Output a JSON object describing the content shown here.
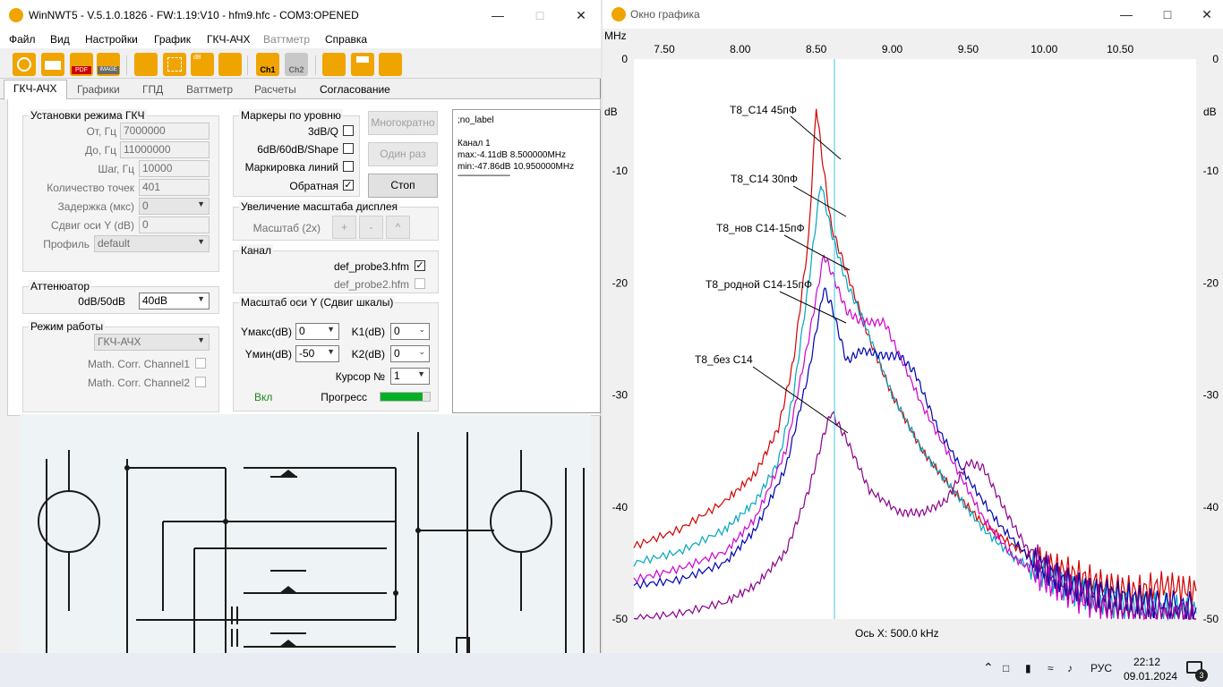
{
  "main_window": {
    "title": "WinNWT5 - V.5.1.0.1826 - FW:1.19:V10 - hfm9.hfc - COM3:OPENED",
    "menu": [
      "Файл",
      "Вид",
      "Настройки",
      "График",
      "ГКЧ-АЧХ",
      "Ваттметр",
      "Справка"
    ],
    "toolbar_icons": [
      "power-icon",
      "print-icon",
      "pdf-icon",
      "image-icon",
      "tools-icon",
      "grid-icon",
      "db-chart-icon",
      "calibrate-icon",
      "ch1-icon",
      "ch2-icon",
      "sweep-icon",
      "save-icon",
      "exchange-icon"
    ],
    "toolbar_text": {
      "pdf": "PDF",
      "image": "IMAGE",
      "db": "dB",
      "ch1": "Ch1",
      "ch2": "Ch2"
    },
    "tabs": [
      "ГКЧ-АЧХ",
      "Графики",
      "ГПД",
      "Ваттметр",
      "Расчеты",
      "Согласование"
    ],
    "generator": {
      "title": "Установки режима ГКЧ",
      "from_label": "От, Гц",
      "from_value": "7000000",
      "to_label": "До, Гц",
      "to_value": "11000000",
      "step_label": "Шаг, Гц",
      "step_value": "10000",
      "points_label": "Количество точек",
      "points_value": "401",
      "delay_label": "Задержка (мкс)",
      "delay_value": "0",
      "yshift_label": "Сдвиг оси Y (dB)",
      "yshift_value": "0",
      "profile_label": "Профиль",
      "profile_value": "default"
    },
    "attenuator": {
      "title": "Аттенюатор",
      "label": "0dB/50dB",
      "value": "40dB"
    },
    "mode": {
      "title": "Режим работы",
      "value": "ГКЧ-АЧХ",
      "corr1": "Math. Corr. Channel1",
      "corr2": "Math. Corr. Channel2"
    },
    "markers": {
      "title": "Маркеры по уровню",
      "m1": "3dB/Q",
      "m2": "6dB/60dB/Shape",
      "m3": "Маркировка линий",
      "m4": "Обратная",
      "m4_checked": "✓"
    },
    "buttons": {
      "multi": "Многократно",
      "once": "Один раз",
      "stop": "Стоп"
    },
    "zoom": {
      "title": "Увеличение масштаба дисплея",
      "label": "Масштаб (2x)",
      "plus": "+",
      "minus": "-",
      "up": "^"
    },
    "channel": {
      "title": "Канал",
      "probe1": "def_probe3.hfm",
      "probe1_checked": "✓",
      "probe2": "def_probe2.hfm"
    },
    "yscale": {
      "title": "Масштаб оси Y (Сдвиг шкалы)",
      "ymax_label": "Yмакс(dB)",
      "ymax_value": "0",
      "ymin_label": "Yмин(dB)",
      "ymin_value": "-50",
      "k1_label": "K1(dB)",
      "k1_value": "0",
      "k2_label": "K2(dB)",
      "k2_value": "0",
      "cursor_label": "Курсор №",
      "cursor_value": "1",
      "on_label": "Вкл",
      "progress_label": "Прогресс",
      "progress_fraction": 0.85
    },
    "info": {
      "line1": ";no_label",
      "line2": "Канал 1",
      "line3": "max:-4.11dB 8.500000MHz",
      "line4": "min:-47.86dB 10.950000MHz",
      "line5": "-------------------------"
    }
  },
  "graph_window": {
    "title": "Окно графика",
    "x_unit": "MHz",
    "y_unit": "dB",
    "x_axis_caption": "Ось X: 500.0 kHz",
    "cursor_color": "#3fc8e0",
    "annotations": [
      "T8_C14 45пФ",
      "T8_C14 30пФ",
      "T8_нов C14-15пФ",
      "T8_родной C14-15пФ",
      "T8_без С14"
    ]
  },
  "chart_data": {
    "type": "line",
    "title": "",
    "xlabel": "Ось X: 500.0 kHz",
    "ylabel": "dB",
    "xlim": [
      7.3,
      11.0
    ],
    "ylim": [
      -50,
      0
    ],
    "x_ticks": [
      "7.50",
      "8.00",
      "8.50",
      "9.00",
      "9.50",
      "10.00",
      "10.50"
    ],
    "x_tick_values": [
      7.5,
      8.0,
      8.5,
      9.0,
      9.5,
      10.0,
      10.5
    ],
    "y_ticks": [
      "0",
      "-10",
      "-20",
      "-30",
      "-40",
      "-50"
    ],
    "y_tick_values": [
      0,
      -10,
      -20,
      -30,
      -40,
      -50
    ],
    "cursor_x": 8.62,
    "grid": false,
    "series": [
      {
        "name": "T8_C14 45пФ",
        "color": "#d40000",
        "x": [
          7.3,
          7.6,
          7.9,
          8.1,
          8.25,
          8.35,
          8.45,
          8.5,
          8.55,
          8.6,
          8.7,
          8.85,
          9.0,
          9.2,
          9.4,
          9.6,
          9.8,
          10.0,
          10.2,
          10.4,
          10.6,
          10.8,
          11.0
        ],
        "y": [
          -43.5,
          -42.0,
          -39.5,
          -37.0,
          -33.0,
          -27.0,
          -16.0,
          -4.2,
          -10.0,
          -15.0,
          -19.0,
          -25.0,
          -30.0,
          -35.0,
          -38.5,
          -41.5,
          -43.5,
          -45.0,
          -46.0,
          -47.0,
          -47.5,
          -47.0,
          -47.5
        ]
      },
      {
        "name": "T8_C14 30пФ",
        "color": "#00a6c0",
        "x": [
          7.3,
          7.6,
          7.9,
          8.1,
          8.25,
          8.35,
          8.45,
          8.53,
          8.6,
          8.7,
          8.8,
          9.0,
          9.2,
          9.4,
          9.6,
          9.8,
          10.0,
          10.2,
          10.4,
          10.6,
          10.8,
          11.0
        ],
        "y": [
          -45.0,
          -44.0,
          -42.0,
          -39.5,
          -36.0,
          -30.0,
          -20.0,
          -11.0,
          -15.5,
          -20.0,
          -23.0,
          -30.0,
          -35.0,
          -38.5,
          -42.0,
          -44.5,
          -46.0,
          -47.5,
          -48.5,
          -49.0,
          -49.0,
          -49.5
        ]
      },
      {
        "name": "T8_нов C14-15пФ",
        "color": "#d000d0",
        "x": [
          7.3,
          7.6,
          7.9,
          8.1,
          8.3,
          8.45,
          8.55,
          8.6,
          8.7,
          8.8,
          8.95,
          9.0,
          9.2,
          9.4,
          9.6,
          9.8,
          10.0,
          10.2,
          10.4,
          10.6,
          10.8,
          11.0
        ],
        "y": [
          -46.5,
          -45.5,
          -44.0,
          -41.0,
          -35.0,
          -25.0,
          -17.5,
          -19.0,
          -22.5,
          -23.5,
          -23.5,
          -25.0,
          -31.0,
          -36.0,
          -41.0,
          -44.5,
          -46.5,
          -48.0,
          -49.0,
          -49.5,
          -49.5,
          -50.0
        ]
      },
      {
        "name": "T8_родной C14-15пФ",
        "color": "#0000b0",
        "x": [
          7.3,
          7.6,
          7.9,
          8.1,
          8.3,
          8.45,
          8.55,
          8.6,
          8.7,
          8.8,
          8.95,
          9.05,
          9.15,
          9.3,
          9.5,
          9.7,
          9.9,
          10.1,
          10.3,
          10.5,
          10.7,
          11.0
        ],
        "y": [
          -47.0,
          -46.5,
          -45.0,
          -42.0,
          -36.5,
          -28.0,
          -20.5,
          -22.0,
          -27.0,
          -26.0,
          -26.5,
          -26.5,
          -28.0,
          -33.0,
          -37.5,
          -41.5,
          -44.5,
          -46.5,
          -47.5,
          -48.0,
          -48.5,
          -49.0
        ]
      },
      {
        "name": "T8_без С14",
        "color": "#8a008a",
        "x": [
          7.3,
          7.6,
          7.9,
          8.1,
          8.3,
          8.45,
          8.55,
          8.6,
          8.7,
          8.85,
          9.05,
          9.2,
          9.35,
          9.5,
          9.6,
          9.75,
          9.9,
          10.1,
          10.3,
          10.5,
          10.7,
          10.9,
          11.0
        ],
        "y": [
          -50.0,
          -49.5,
          -48.5,
          -47.0,
          -44.0,
          -38.5,
          -33.5,
          -31.5,
          -34.0,
          -38.5,
          -40.5,
          -40.5,
          -39.5,
          -36.0,
          -36.5,
          -40.5,
          -44.0,
          -46.5,
          -48.0,
          -49.0,
          -49.5,
          -49.5,
          -50.0
        ]
      }
    ]
  },
  "taskbar": {
    "lang": "РУС",
    "time": "22:12",
    "date": "09.01.2024",
    "badge": "3"
  }
}
